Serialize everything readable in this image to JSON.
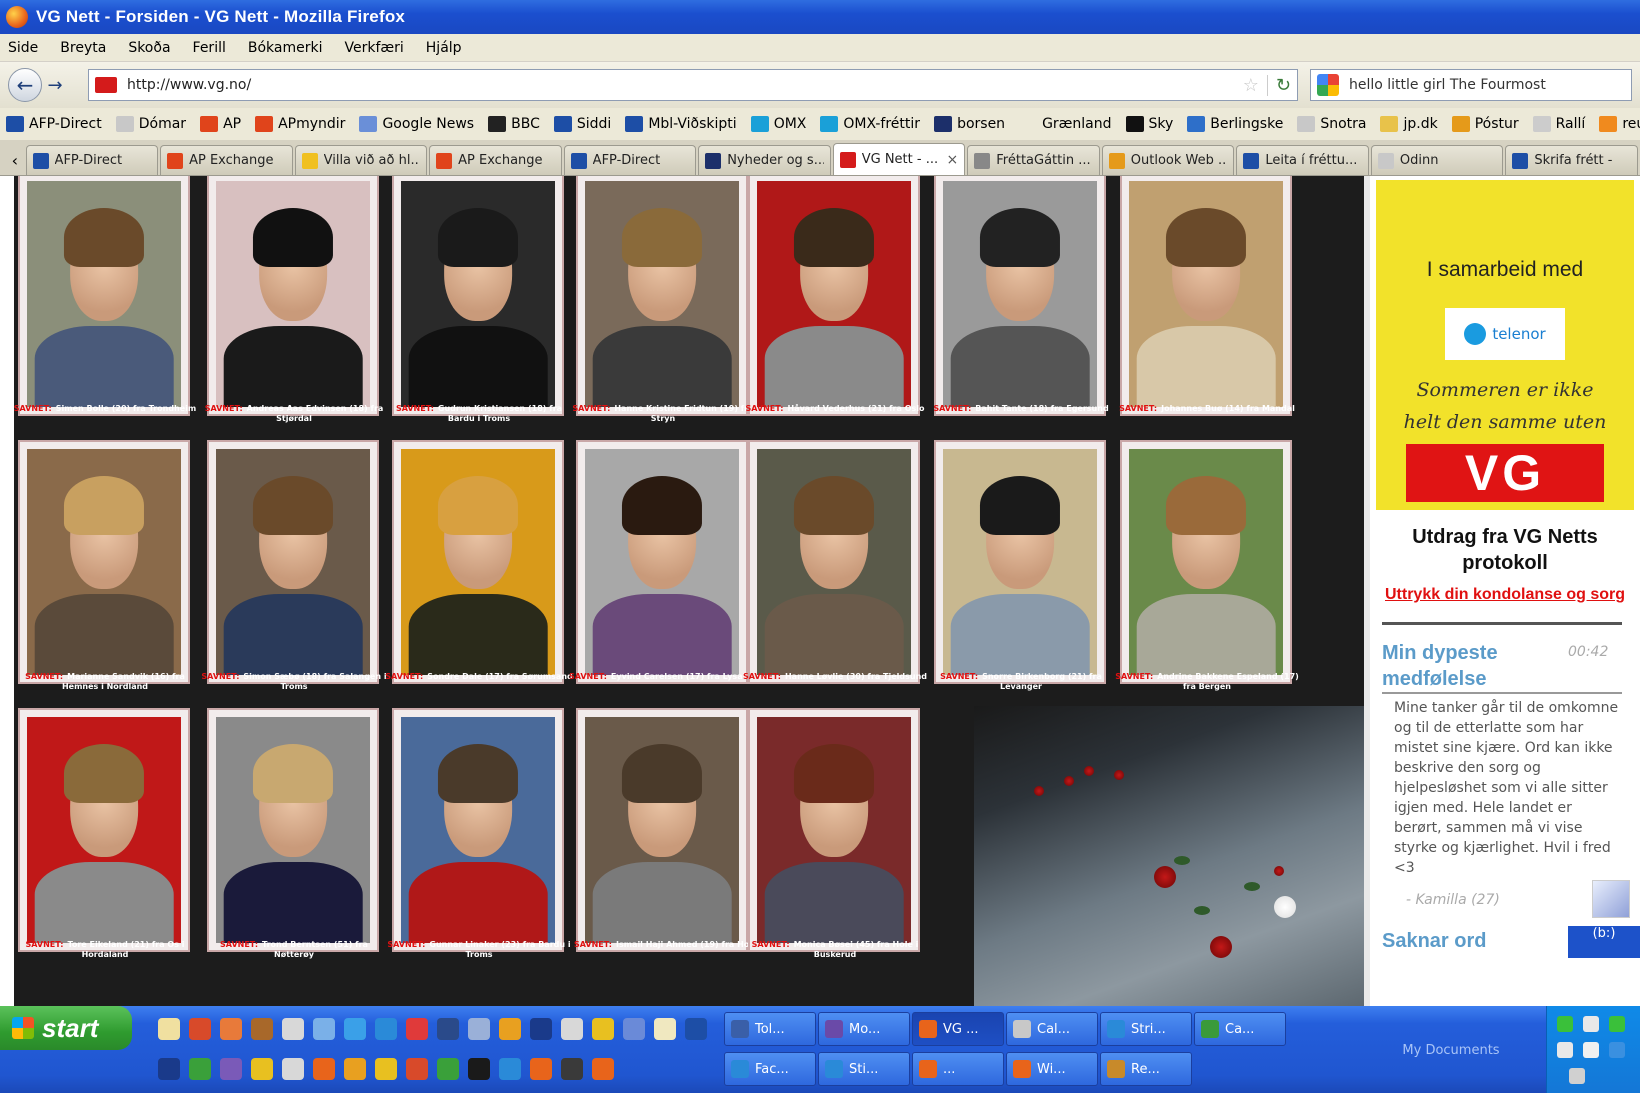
{
  "window": {
    "title": "VG Nett - Forsiden - VG Nett - Mozilla Firefox"
  },
  "menu": [
    "Side",
    "Breyta",
    "Skoða",
    "Ferill",
    "Bókamerki",
    "Verkfæri",
    "Hjálp"
  ],
  "nav": {
    "url": "http://www.vg.no/",
    "search_query": "hello little girl The Fourmost"
  },
  "bookmarks": [
    {
      "label": "AFP-Direct",
      "icon": "afp-icon",
      "color": "#1d4ea6"
    },
    {
      "label": "Dómar",
      "icon": "page-icon",
      "color": "#c8c8c8"
    },
    {
      "label": "AP",
      "icon": "ap-icon",
      "color": "#e0441b"
    },
    {
      "label": "APmyndir",
      "icon": "ap-icon",
      "color": "#e0441b"
    },
    {
      "label": "Google News",
      "icon": "google-icon",
      "color": "#6a8fd8"
    },
    {
      "label": "BBC",
      "icon": "bbc-icon",
      "color": "#222222"
    },
    {
      "label": "Siddi",
      "icon": "jn-icon",
      "color": "#1d4ea6"
    },
    {
      "label": "Mbl-Viðskipti",
      "icon": "jn-icon",
      "color": "#1d4ea6"
    },
    {
      "label": "OMX",
      "icon": "n-icon",
      "color": "#1aa0d8"
    },
    {
      "label": "OMX-fréttir",
      "icon": "n-icon",
      "color": "#1aa0d8"
    },
    {
      "label": "borsen",
      "icon": "b-icon",
      "color": "#1c2f6a"
    },
    {
      "label": "Grænland",
      "icon": "dot-icon",
      "color": "#ece9d8"
    },
    {
      "label": "Sky",
      "icon": "sky-icon",
      "color": "#111111"
    },
    {
      "label": "Berlingske",
      "icon": "globe-icon",
      "color": "#2e6fc9"
    },
    {
      "label": "Snotra",
      "icon": "page-icon",
      "color": "#c8c8c8"
    },
    {
      "label": "jp.dk",
      "icon": "folder-icon",
      "color": "#e8c24a"
    },
    {
      "label": "Póstur",
      "icon": "outlook-icon",
      "color": "#e59a1a"
    },
    {
      "label": "Rallí",
      "icon": "wrc-icon",
      "color": "#cccccc"
    },
    {
      "label": "reuters",
      "icon": "reuters-icon",
      "color": "#f08a1e"
    }
  ],
  "tabs": [
    {
      "label": "AFP-Direct",
      "color": "#1d4ea6",
      "active": false
    },
    {
      "label": "AP Exchange",
      "color": "#e0441b",
      "active": false
    },
    {
      "label": "Villa við að hl...",
      "color": "#f0c020",
      "active": false
    },
    {
      "label": "AP Exchange",
      "color": "#e0441b",
      "active": false
    },
    {
      "label": "AFP-Direct",
      "color": "#1d4ea6",
      "active": false
    },
    {
      "label": "Nyheder og s...",
      "color": "#1c2f6a",
      "active": false
    },
    {
      "label": "VG Nett - ...",
      "color": "#d41b1b",
      "active": true
    },
    {
      "label": "FréttaGáttin ...",
      "color": "#888888",
      "active": false
    },
    {
      "label": "Outlook Web ...",
      "color": "#e59a1a",
      "active": false
    },
    {
      "label": "Leita í fréttu...",
      "color": "#1d4ea6",
      "active": false
    },
    {
      "label": "Odinn",
      "color": "#c8c8c8",
      "active": false
    },
    {
      "label": "Skrifa frétt -",
      "color": "#1d4ea6",
      "active": false
    }
  ],
  "memorial": {
    "missing_label": "SAVNET:",
    "people": [
      {
        "caption": "Simen Bolle (20) fra Trondheim",
        "bg": "#8b8f7a",
        "hair": "#6a4a2a",
        "body": "#4a5a7a"
      },
      {
        "caption": "Andreas Aas Edvinsen (18) fra Stjørdal",
        "bg": "#d8c0c0",
        "hair": "#111111",
        "body": "#1a1a1a"
      },
      {
        "caption": "Gudrun Kristiansen (18) fra Bardu i Troms",
        "bg": "#2a2a2a",
        "hair": "#1a1a1a",
        "body": "#111111"
      },
      {
        "caption": "Hanne Kristine Fridtun (19) fra Stryn",
        "bg": "#7a6a5a",
        "hair": "#8a6a3a",
        "body": "#3a3a3a"
      },
      {
        "caption": "Håvard Vederhus (21) fra Oslo",
        "bg": "#b01818",
        "hair": "#3a2a1a",
        "body": "#8a8a8a"
      },
      {
        "caption": "Bahit Tante (18) fra Egersund",
        "bg": "#9a9a9a",
        "hair": "#222222",
        "body": "#555555"
      },
      {
        "caption": "Johannes Buø (14) fra Mandal",
        "bg": "#c0a070",
        "hair": "#6a4a2a",
        "body": "#d8c8a8"
      },
      {
        "caption": "Marianne Sandvik (16) fra Hemnes i Nordland",
        "bg": "#8a6a4a",
        "hair": "#c8a060",
        "body": "#5a4a3a"
      },
      {
        "caption": "Simon Sæbø (18) fra Salangen i Troms",
        "bg": "#6a5a4a",
        "hair": "#6a4a2a",
        "body": "#2a3a5a"
      },
      {
        "caption": "Sondre Dale (17) fra Sørumsand",
        "bg": "#d89a1a",
        "hair": "#d8a040",
        "body": "#2a2a1a"
      },
      {
        "caption": "Eyvind Carelsen (17) fra Lysaker",
        "bg": "#a8a8a8",
        "hair": "#2a1a10",
        "body": "#6a4a7a"
      },
      {
        "caption": "Hanne Løvlie (30) fra Tjeldsund",
        "bg": "#5a5a4a",
        "hair": "#6a4a2a",
        "body": "#6a5a4a"
      },
      {
        "caption": "Snorre Birkenborg (21) fra Levanger",
        "bg": "#c8b890",
        "hair": "#1a1a1a",
        "body": "#8a9aaa"
      },
      {
        "caption": "Andrine Bakkene Espeland (17) fra Bergen",
        "bg": "#6a8a4a",
        "hair": "#9a6a3a",
        "body": "#a8a898"
      },
      {
        "caption": "Tore Eikeland (21) fra Os i Hordaland",
        "bg": "#c01818",
        "hair": "#8a6a3a",
        "body": "#8a8a8a"
      },
      {
        "caption": "Trond Berntsen (51) fra Nøtterøy",
        "bg": "#8a8a8a",
        "hair": "#c8a870",
        "body": "#1a1a3a"
      },
      {
        "caption": "Gunnar Linaker (23) fra Bardu i Troms",
        "bg": "#4a6a9a",
        "hair": "#4a3a2a",
        "body": "#b01818"
      },
      {
        "caption": "Ismail Haji Ahmed (19) fra Hol",
        "bg": "#6a5a4a",
        "hair": "#4a3a2a",
        "body": "#7a7a7a"
      },
      {
        "caption": "Monica Bøsei (45) fra Hole i Buskerud",
        "bg": "#7a2a2a",
        "hair": "#6a2a1a",
        "body": "#4a4a5a"
      }
    ]
  },
  "sidebar": {
    "ad": {
      "coop_text": "I samarbeid med",
      "telenor": "telenor",
      "slogan_line1": "Sommeren er ikke",
      "slogan_line2": "helt den samme uten",
      "vg_logo": "VG"
    },
    "extract_heading": "Utdrag fra VG Netts protokoll",
    "condolence_link": "Uttrykk din kondolanse og sorg",
    "post": {
      "title": "Min dypeste medfølelse",
      "time": "00:42",
      "body": "Mine tanker går til de omkomne og til de etterlatte som har mistet sine kjære. Ord kan ikke beskrive den sorg og hjelpesløshet som vi alle sitter igjen med. Hele landet er berørt, sammen må vi vise styrke og kjærlighet. Hvil i fred <3",
      "author": "- Kamilla (27)"
    },
    "next_title": "Saknar ord",
    "corner_tab": "(b:)"
  },
  "taskbar": {
    "start_label": "start",
    "buttons_row1": [
      {
        "label": "Tol...",
        "color": "#3a5fa8"
      },
      {
        "label": "Mo...",
        "color": "#6a4aa8"
      },
      {
        "label": "VG ...",
        "color": "#e8641b"
      },
      {
        "label": "Cal...",
        "color": "#c8c8c8"
      },
      {
        "label": "Stri...",
        "color": "#2a8ad8"
      },
      {
        "label": "Ca...",
        "color": "#3a9a3a"
      }
    ],
    "buttons_row2": [
      {
        "label": "Fac...",
        "color": "#2a8ad8"
      },
      {
        "label": "Sti...",
        "color": "#2a8ad8"
      },
      {
        "label": "...",
        "color": "#e8641b"
      },
      {
        "label": "Wi...",
        "color": "#e8641b"
      },
      {
        "label": "Re...",
        "color": "#c88a2a"
      }
    ],
    "my_documents": "My Documents"
  }
}
